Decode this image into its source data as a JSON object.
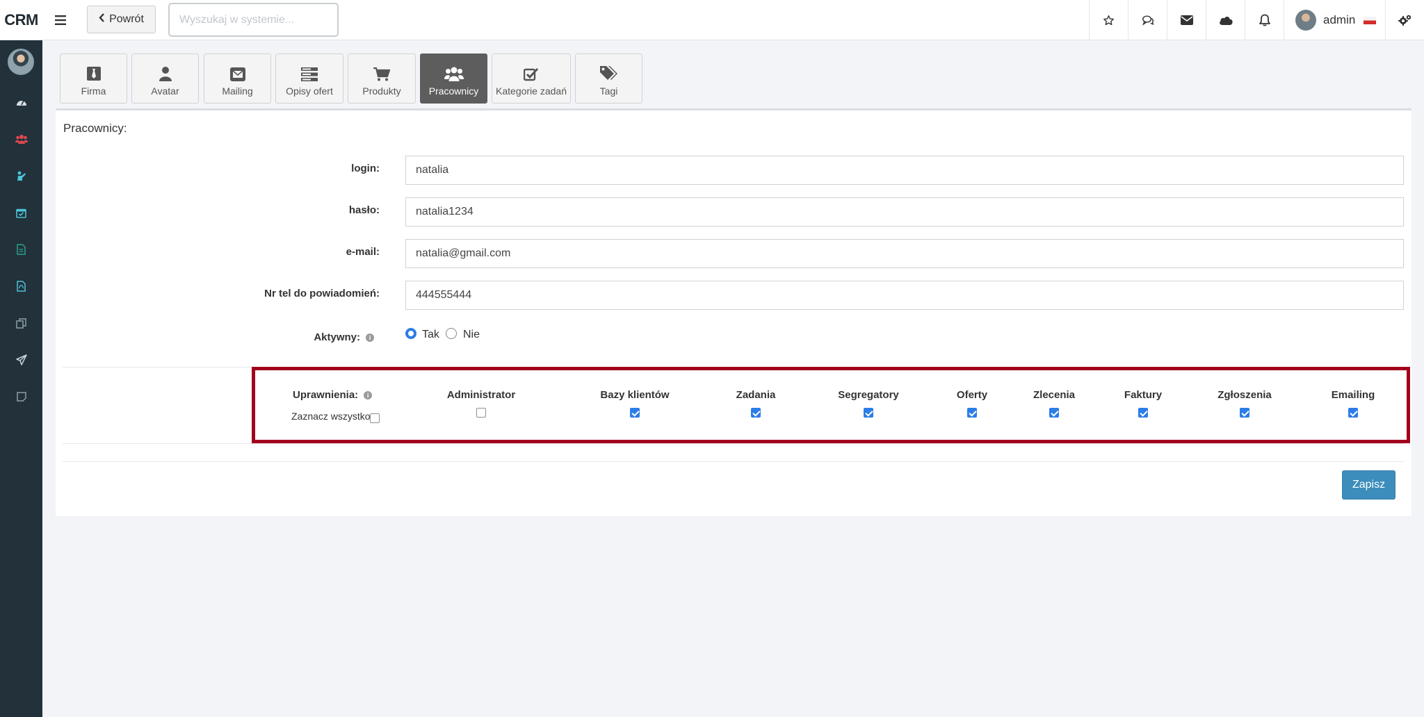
{
  "app": {
    "brand": "CRM"
  },
  "toolbar": {
    "back_label": "Powrót",
    "search_placeholder": "Wyszukaj w systemie...",
    "user_name": "admin"
  },
  "tabs": [
    {
      "label": "Firma",
      "icon": "tie-icon"
    },
    {
      "label": "Avatar",
      "icon": "user-icon"
    },
    {
      "label": "Mailing",
      "icon": "envelope-icon"
    },
    {
      "label": "Opisy ofert",
      "icon": "server-icon"
    },
    {
      "label": "Produkty",
      "icon": "cart-icon"
    },
    {
      "label": "Pracownicy",
      "icon": "users-icon",
      "active": true
    },
    {
      "label": "Kategorie zadań",
      "icon": "checkbox-icon"
    },
    {
      "label": "Tagi",
      "icon": "tags-icon"
    }
  ],
  "panel": {
    "title": "Pracownicy:",
    "fields": {
      "login": {
        "label": "login:",
        "value": "natalia"
      },
      "haslo": {
        "label": "hasło:",
        "value": "natalia1234"
      },
      "email": {
        "label": "e-mail:",
        "value": "natalia@gmail.com"
      },
      "phone": {
        "label": "Nr tel do powiadomień:",
        "value": "444555444"
      }
    },
    "active": {
      "label": "Aktywny:",
      "yes": "Tak",
      "no": "Nie",
      "selected": "Tak"
    },
    "permissions": {
      "label": "Uprawnienia:",
      "select_all": "Zaznacz wszystko",
      "items": [
        {
          "label": "Administrator",
          "checked": false
        },
        {
          "label": "Bazy klientów",
          "checked": true
        },
        {
          "label": "Zadania",
          "checked": true
        },
        {
          "label": "Segregatory",
          "checked": true
        },
        {
          "label": "Oferty",
          "checked": true
        },
        {
          "label": "Zlecenia",
          "checked": true
        },
        {
          "label": "Faktury",
          "checked": true
        },
        {
          "label": "Zgłoszenia",
          "checked": true
        },
        {
          "label": "Emailing",
          "checked": true
        }
      ]
    },
    "save_label": "Zapisz"
  },
  "colors": {
    "sidebar": "#22313a",
    "accent": "#3c8dbc",
    "highlight_border": "#a3001e",
    "checkbox": "#2c7de6"
  }
}
